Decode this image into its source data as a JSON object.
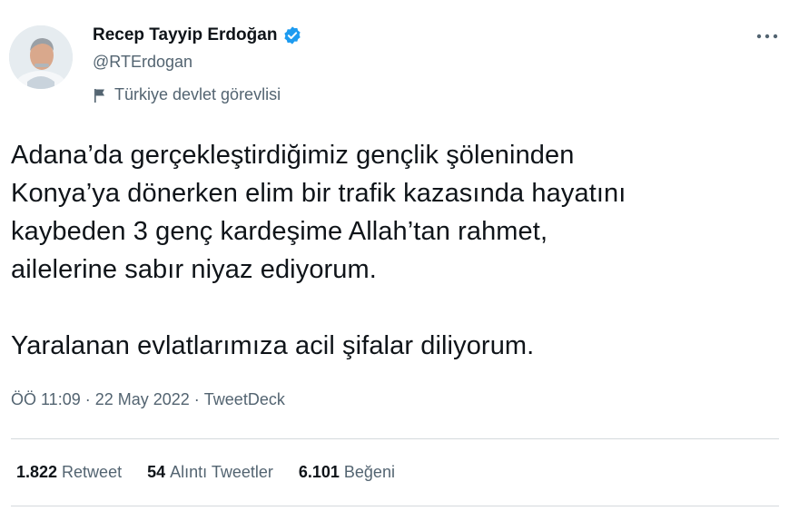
{
  "author": {
    "name": "Recep Tayyip Erdoğan",
    "handle": "@RTErdogan",
    "label": "Türkiye devlet görevlisi",
    "avatar_icon": "profile-photo",
    "verified_color": "#1d9bf0"
  },
  "tweet": {
    "text": "Adana’da gerçekleştirdiğimiz gençlik şöleninden\nKonya’ya dönerken elim bir trafik kazasında hayatını\nkaybeden 3 genç kardeşime Allah’tan rahmet,\nailelerine sabır niyaz ediyorum.\n\nYaralanan evlatlarımıza acil şifalar diliyorum."
  },
  "meta": {
    "time": "ÖÖ 11:09",
    "separator": " · ",
    "date": "22 May 2022",
    "source": "TweetDeck"
  },
  "stats": [
    {
      "count": "1.822",
      "label": "Retweet"
    },
    {
      "count": "54",
      "label": "Alıntı Tweetler"
    },
    {
      "count": "6.101",
      "label": "Beğeni"
    }
  ],
  "icons": {
    "more": "more-horizontal-icon",
    "verified": "verified-badge-icon",
    "flag": "government-flag-icon"
  }
}
